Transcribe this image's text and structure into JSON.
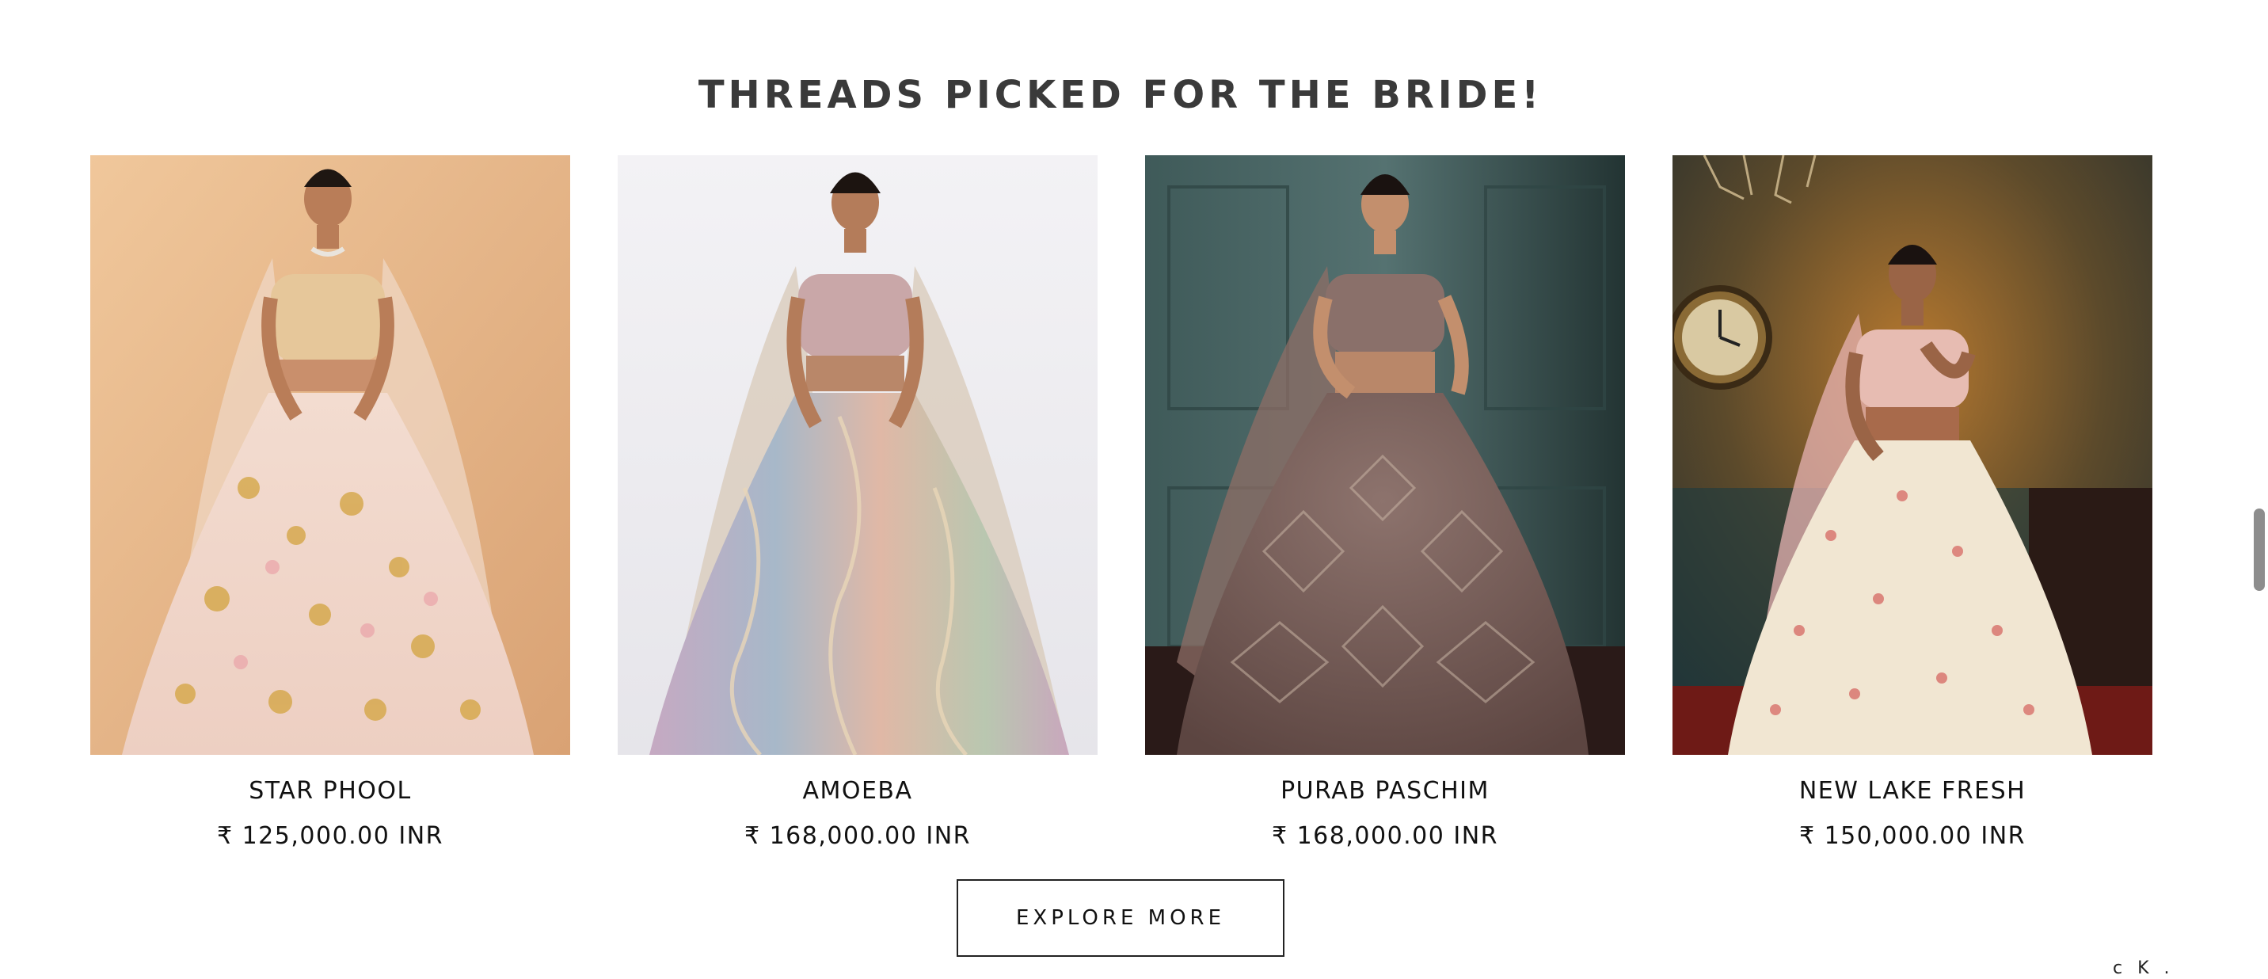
{
  "section": {
    "title": "THREADS PICKED FOR THE BRIDE!"
  },
  "products": [
    {
      "name": "STAR PHOOL",
      "price": "₹ 125,000.00 INR",
      "image_icon": "lehenga-photo",
      "background": "#e8b88a",
      "outfit": "#f1d8c8"
    },
    {
      "name": "AMOEBA",
      "price": "₹ 168,000.00 INR",
      "image_icon": "lehenga-photo",
      "background": "#ecebee",
      "outfit": "#c9b6c4"
    },
    {
      "name": "PURAB PASCHIM",
      "price": "₹ 168,000.00 INR",
      "image_icon": "lehenga-photo",
      "background": "#466361",
      "outfit": "#7b5f5a"
    },
    {
      "name": "NEW LAKE FRESH",
      "price": "₹ 150,000.00 INR",
      "image_icon": "lehenga-photo",
      "background": "#5a4a2a",
      "outfit": "#efe4d0"
    }
  ],
  "cta": {
    "label": "EXPLORE MORE"
  },
  "corner_text": "c K ."
}
